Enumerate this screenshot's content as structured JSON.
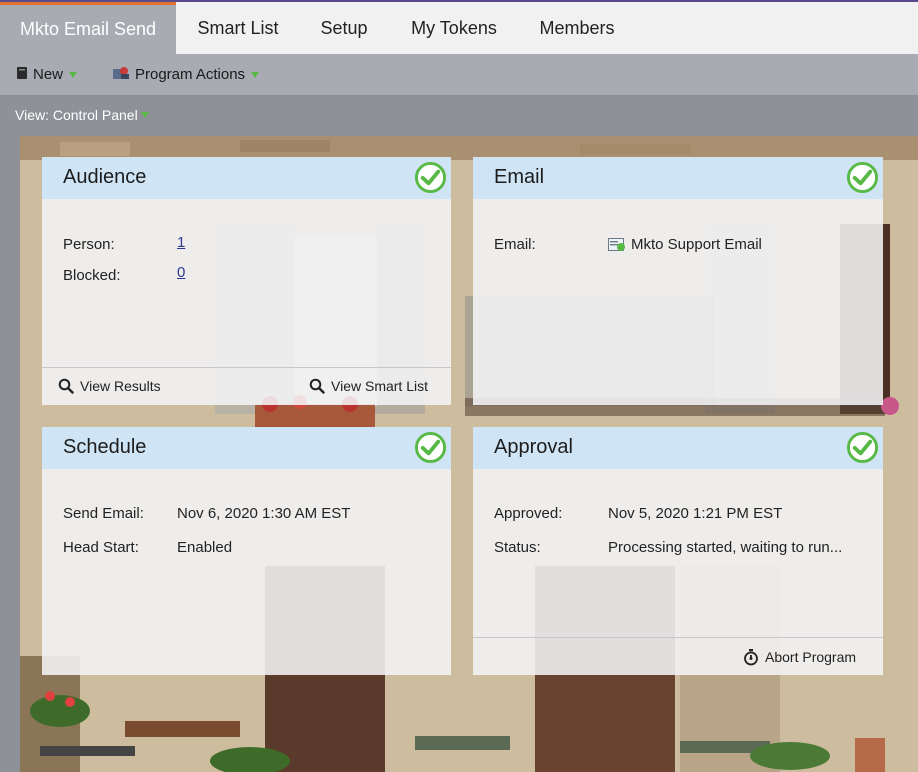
{
  "tabs": [
    {
      "label": "Mkto Email Send",
      "active": true
    },
    {
      "label": "Smart List",
      "active": false
    },
    {
      "label": "Setup",
      "active": false
    },
    {
      "label": "My Tokens",
      "active": false
    },
    {
      "label": "Members",
      "active": false
    }
  ],
  "toolbar": {
    "new_label": "New",
    "program_actions_label": "Program Actions"
  },
  "view": {
    "label": "View: Control Panel"
  },
  "cards": {
    "audience": {
      "title": "Audience",
      "person_label": "Person:",
      "person_value": "1",
      "blocked_label": "Blocked:",
      "blocked_value": "0",
      "view_results_label": "View Results",
      "view_smart_list_label": "View Smart List"
    },
    "email": {
      "title": "Email",
      "email_label": "Email:",
      "email_value": "Mkto Support Email"
    },
    "schedule": {
      "title": "Schedule",
      "send_email_label": "Send Email:",
      "send_email_value": "Nov 6, 2020 1:30 AM EST",
      "head_start_label": "Head Start:",
      "head_start_value": "Enabled"
    },
    "approval": {
      "title": "Approval",
      "approved_label": "Approved:",
      "approved_value": "Nov 5, 2020 1:21 PM EST",
      "status_label": "Status:",
      "status_value": "Processing started, waiting to run...",
      "abort_label": "Abort Program"
    }
  },
  "colors": {
    "accent_tab": "#e2702f",
    "check_green": "#58b947",
    "card_header": "#cce4f4"
  }
}
